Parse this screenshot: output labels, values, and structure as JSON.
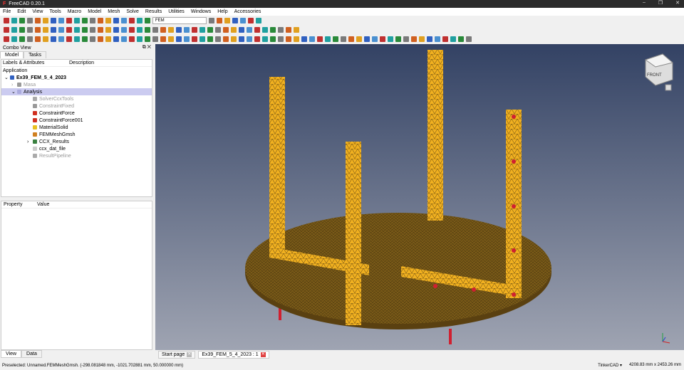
{
  "window": {
    "title": "FreeCAD 0.20.1"
  },
  "menu": [
    "File",
    "Edit",
    "View",
    "Tools",
    "Macro",
    "Model",
    "Mesh",
    "Solve",
    "Results",
    "Utilities",
    "Windows",
    "Help",
    "Accessories"
  ],
  "toolbar": {
    "workbench": "FEM"
  },
  "combo": {
    "title": "Combo View",
    "tabs": [
      "Model",
      "Tasks"
    ],
    "bottom_tabs": [
      "View",
      "Data"
    ]
  },
  "tree": {
    "headers": [
      "Labels & Attributes",
      "Description"
    ],
    "root": "Application",
    "items": [
      {
        "label": "Ex39_FEM_5_4_2023",
        "depth": 0,
        "color": "#3060c0"
      },
      {
        "label": "Masa",
        "depth": 1,
        "color": "#999999"
      },
      {
        "label": "Analysis",
        "depth": 1,
        "color": "#aaaadd"
      },
      {
        "label": "SolverCcxTools",
        "depth": 2,
        "color": "#aaaaaa"
      },
      {
        "label": "ConstraintFixed",
        "depth": 2,
        "color": "#999999"
      },
      {
        "label": "ConstraintForce",
        "depth": 2,
        "color": "#d03020"
      },
      {
        "label": "ConstraintForce001",
        "depth": 2,
        "color": "#d03020"
      },
      {
        "label": "MaterialSolid",
        "depth": 2,
        "color": "#e8c020"
      },
      {
        "label": "FEMMeshGmsh",
        "depth": 2,
        "color": "#d08020"
      },
      {
        "label": "CCX_Results",
        "depth": 2,
        "color": "#3a8040"
      },
      {
        "label": "ccx_dat_file",
        "depth": 2,
        "color": "#cccccc"
      },
      {
        "label": "ResultPipeline",
        "depth": 2,
        "color": "#aaaaaa"
      }
    ]
  },
  "properties": {
    "headers": [
      "Property",
      "Value"
    ]
  },
  "doc_tabs": [
    "Start page",
    "Ex39_FEM_5_4_2023 : 1"
  ],
  "status": {
    "message": "Preselected: Unnamed.FEMMeshGmsh. (-298.081848 mm, -1021.702881 mm, 50.000000 mm)",
    "nav": "TinkerCAD ▾",
    "dims": "4208.83 mm x 2453.26 mm"
  },
  "navcube": {
    "face": "FRONT"
  }
}
